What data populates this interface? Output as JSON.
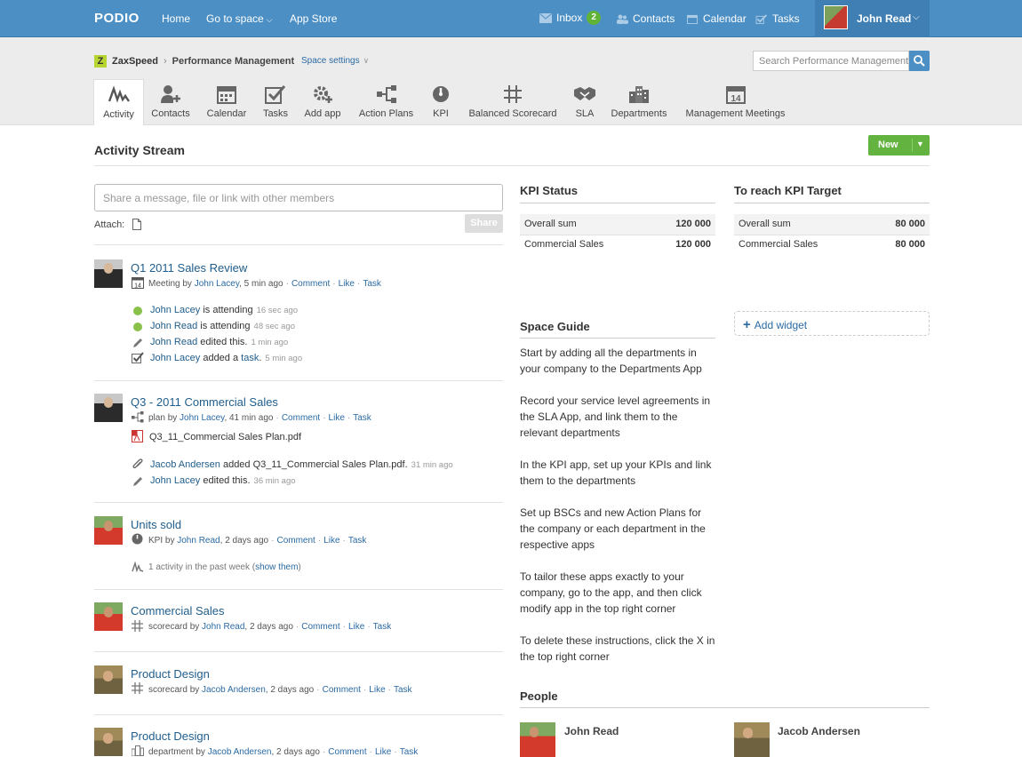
{
  "topbar": {
    "logo": "PODIO",
    "nav": [
      "Home",
      "Go to space",
      "App Store"
    ],
    "inbox_label": "Inbox",
    "inbox_count": "2",
    "contacts_label": "Contacts",
    "calendar_label": "Calendar",
    "tasks_label": "Tasks",
    "user_name": "John Read"
  },
  "breadcrumb": {
    "org": "ZaxSpeed",
    "space": "Performance Management",
    "settings": "Space settings"
  },
  "search": {
    "placeholder": "Search Performance Management"
  },
  "apps": [
    "Activity",
    "Contacts",
    "Calendar",
    "Tasks",
    "Add app",
    "Action Plans",
    "KPI",
    "Balanced Scorecard",
    "SLA",
    "Departments",
    "Management Meetings"
  ],
  "activity": {
    "title": "Activity Stream",
    "new_button": "New",
    "share_placeholder": "Share a message, file or link with other members",
    "attach_label": "Attach:",
    "share_button": "Share"
  },
  "feed": [
    {
      "title": "Q1 2011 Sales Review",
      "type": "Meeting",
      "by": "John Lacey",
      "time": "5 min ago",
      "actions": [
        "Comment",
        "Like",
        "Task"
      ],
      "subitems": [
        {
          "user": "John Lacey",
          "text": "is attending",
          "time": "16 sec ago"
        },
        {
          "user": "John Read",
          "text": "is attending",
          "time": "48 sec ago"
        },
        {
          "user": "John Read",
          "text": "edited this.",
          "time": "1 min ago"
        },
        {
          "user": "John Lacey",
          "text": "added a",
          "link": "task",
          "tail": ".",
          "time": "5 min ago"
        }
      ]
    },
    {
      "title": "Q3 - 2011 Commercial Sales",
      "type": "plan",
      "by": "John Lacey",
      "time": "41 min ago",
      "actions": [
        "Comment",
        "Like",
        "Task"
      ],
      "file": "Q3_11_Commercial Sales Plan.pdf",
      "subitems": [
        {
          "user": "Jacob Andersen",
          "text": "added Q3_11_Commercial Sales Plan.pdf.",
          "time": "31 min ago"
        },
        {
          "user": "John Lacey",
          "text": "edited this.",
          "time": "36 min ago"
        }
      ]
    },
    {
      "title": "Units sold",
      "type": "KPI",
      "by": "John Read",
      "time": "2 days ago",
      "actions": [
        "Comment",
        "Like",
        "Task"
      ],
      "summary": "1 activity in the past week (",
      "summary_link": "show them",
      "summary_tail": ")"
    },
    {
      "title": "Commercial Sales",
      "type": "scorecard",
      "by": "John Read",
      "time": "2 days ago",
      "actions": [
        "Comment",
        "Like",
        "Task"
      ]
    },
    {
      "title": "Product Design",
      "type": "scorecard",
      "by": "Jacob Andersen",
      "time": "2 days ago",
      "actions": [
        "Comment",
        "Like",
        "Task"
      ]
    },
    {
      "title": "Product Design",
      "type": "department",
      "by": "Jacob Andersen",
      "time": "2 days ago",
      "actions": [
        "Comment",
        "Like",
        "Task"
      ]
    }
  ],
  "by_word": "by",
  "kpi_status": {
    "title": "KPI Status",
    "rows": [
      {
        "label": "Overall sum",
        "value": "120 000"
      },
      {
        "label": "Commercial Sales",
        "value": "120 000"
      }
    ]
  },
  "kpi_target": {
    "title": "To reach KPI Target",
    "rows": [
      {
        "label": "Overall sum",
        "value": "80 000"
      },
      {
        "label": "Commercial Sales",
        "value": "80 000"
      }
    ]
  },
  "add_widget": "Add widget",
  "space_guide": {
    "title": "Space Guide",
    "paragraphs": [
      "Start by adding all the departments in your company to the Departments App",
      "Record your service level agreements in the SLA App, and link them to the relevant departments",
      "In the KPI app, set up your KPIs and link them to the departments",
      "Set up BSCs and new Action Plans for the company or each department in the respective apps",
      "To tailor these apps exactly to your company, go to the app, and then click modify app in the top right corner",
      "To delete these instructions, click the X in the top right corner"
    ]
  },
  "people": {
    "title": "People",
    "members": [
      "John Read",
      "Jacob Andersen"
    ]
  },
  "colors": {
    "topbar": "#4c8fc4",
    "accent_green": "#62b33f",
    "link": "#1f5d8c"
  }
}
